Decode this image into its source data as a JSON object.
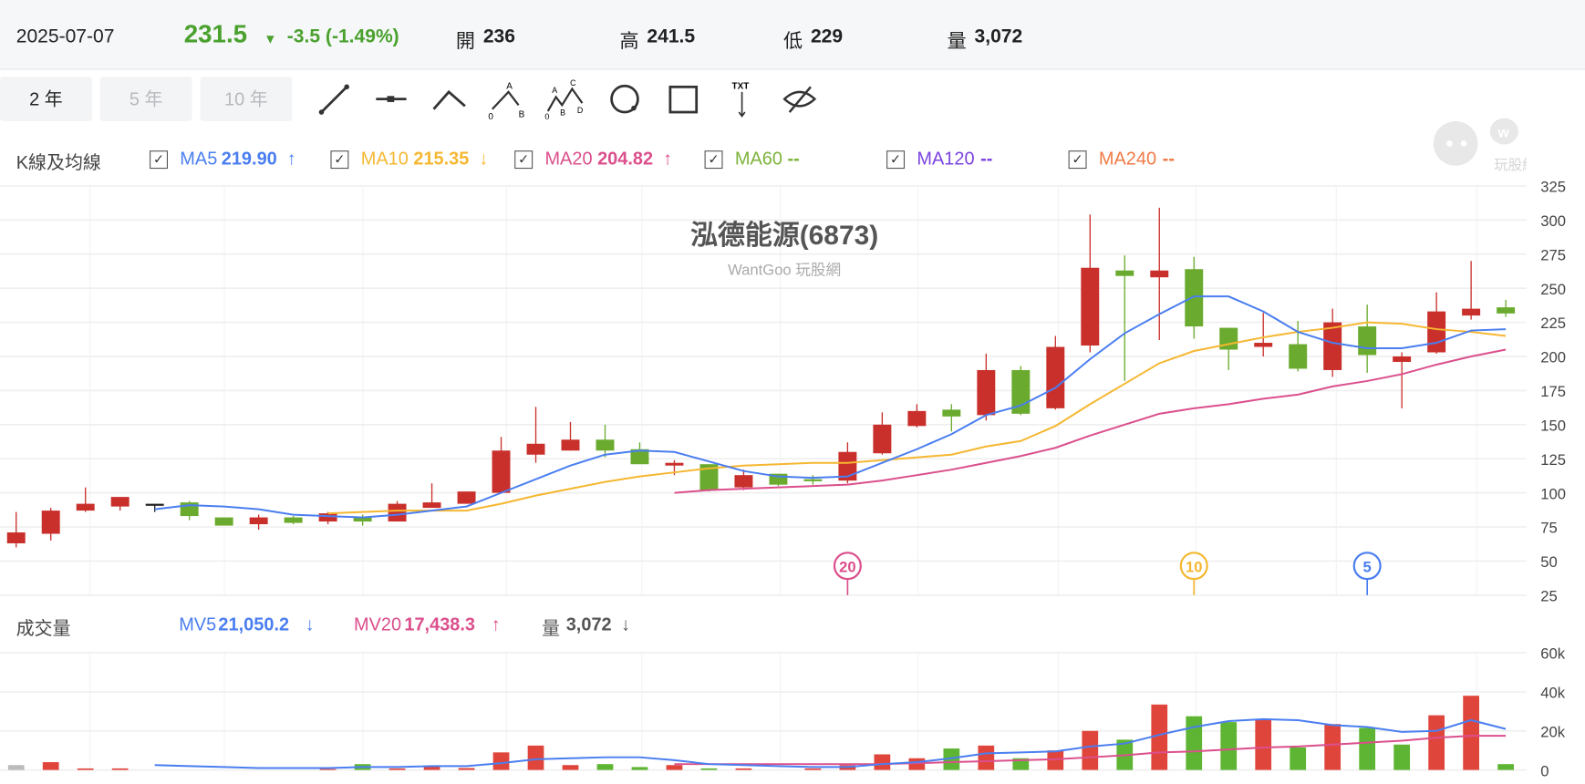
{
  "quote": {
    "date": "2025-07-07",
    "price": "231.5",
    "direction": "down",
    "change": "-3.5 (-1.49%)",
    "open_label": "開",
    "open": "236",
    "high_label": "高",
    "high": "241.5",
    "low_label": "低",
    "low": "229",
    "vol_label": "量",
    "volume": "3,072"
  },
  "ranges": [
    {
      "label": "2 年",
      "active": true
    },
    {
      "label": "5 年",
      "active": false
    },
    {
      "label": "10 年",
      "active": false
    }
  ],
  "tools": [
    "line-tool-icon",
    "horizontal-line-tool-icon",
    "angle-tool-icon",
    "abc-pattern-tool-icon",
    "abcd-pattern-tool-icon",
    "circle-tool-icon",
    "rectangle-tool-icon",
    "text-tool-icon",
    "hide-drawings-icon"
  ],
  "tool_text": {
    "txt": "TXT",
    "a": "A",
    "b": "B",
    "c": "C",
    "d": "D",
    "zero": "0"
  },
  "legend": {
    "title": "K線及均線",
    "items": [
      {
        "name": "MA5",
        "value": "219.90",
        "arrow": "↑",
        "color": "#4a7ef0",
        "checked": true
      },
      {
        "name": "MA10",
        "value": "215.35",
        "arrow": "↓",
        "color": "#f5b731",
        "checked": true
      },
      {
        "name": "MA20",
        "value": "204.82",
        "arrow": "↑",
        "color": "#db4f8c",
        "checked": true
      },
      {
        "name": "MA60",
        "value": "--",
        "arrow": "",
        "color": "#7cb33a",
        "checked": true
      },
      {
        "name": "MA120",
        "value": "--",
        "arrow": "",
        "color": "#7a43e0",
        "checked": true
      },
      {
        "name": "MA240",
        "value": "--",
        "arrow": "",
        "color": "#f07a45",
        "checked": true
      }
    ]
  },
  "watermark": {
    "title": "泓德能源(6873)",
    "subtitle": "WantGoo 玩股網",
    "logo_text": "玩股網"
  },
  "colors": {
    "up": "#c9302c",
    "down": "#6aab2f",
    "vol_up": "#e0453c",
    "vol_down": "#5db533",
    "grid": "#eeeeee"
  },
  "chart_data": [
    {
      "type": "candlestick",
      "y_ticks": [
        325,
        300,
        275,
        250,
        225,
        200,
        175,
        150,
        125,
        100,
        75,
        50,
        25
      ],
      "ylim": [
        25,
        325
      ],
      "candles": [
        [
          63,
          71,
          86,
          60
        ],
        [
          70,
          87,
          89,
          65
        ],
        [
          87,
          92,
          104,
          86
        ],
        [
          90,
          97,
          97,
          87
        ],
        [
          92,
          92,
          92,
          86
        ],
        [
          93,
          83,
          94,
          80
        ],
        [
          82,
          76,
          82,
          76
        ],
        [
          77,
          82,
          84,
          73
        ],
        [
          82,
          78,
          83,
          77
        ],
        [
          79,
          85,
          86,
          77
        ],
        [
          82,
          79,
          84,
          76
        ],
        [
          79,
          92,
          94,
          79
        ],
        [
          89,
          93,
          107,
          89
        ],
        [
          92,
          101,
          101,
          92
        ],
        [
          100,
          131,
          141,
          100
        ],
        [
          128,
          136,
          163,
          122
        ],
        [
          131,
          139,
          152,
          131
        ],
        [
          139,
          131,
          150,
          126
        ],
        [
          132,
          121,
          137,
          121
        ],
        [
          120,
          122,
          124,
          113
        ],
        [
          121,
          102,
          121,
          101
        ],
        [
          104,
          113,
          117,
          102
        ],
        [
          114,
          106,
          114,
          105
        ],
        [
          110,
          109,
          113,
          106
        ],
        [
          109,
          130,
          137,
          107
        ],
        [
          129,
          150,
          159,
          128
        ],
        [
          149,
          160,
          165,
          148
        ],
        [
          161,
          156,
          165,
          145
        ],
        [
          157,
          190,
          202,
          153
        ],
        [
          190,
          158,
          193,
          157
        ],
        [
          162,
          207,
          215,
          161
        ],
        [
          208,
          265,
          304,
          203
        ],
        [
          263,
          259,
          274,
          182
        ],
        [
          258,
          263,
          309,
          212
        ],
        [
          264,
          222,
          273,
          213
        ],
        [
          221,
          205,
          221,
          190
        ],
        [
          207,
          210,
          232,
          200
        ],
        [
          209,
          191,
          226,
          189
        ],
        [
          190,
          225,
          235,
          185
        ],
        [
          222,
          201,
          238,
          188
        ],
        [
          196,
          200,
          203,
          162
        ],
        [
          203,
          233,
          247,
          202
        ],
        [
          230,
          235,
          270,
          227
        ],
        [
          236,
          231.5,
          241.5,
          229
        ]
      ],
      "candle_fields": [
        "open",
        "close",
        "high",
        "low"
      ],
      "ma5": {
        "start": 4,
        "values": [
          88,
          91,
          90,
          88,
          84,
          83,
          82,
          84,
          87,
          90,
          100,
          110,
          120,
          128,
          131,
          130,
          123,
          116,
          112,
          111,
          112,
          122,
          132,
          143,
          157,
          164,
          177,
          198,
          217,
          231,
          244,
          244,
          233,
          218,
          210,
          206,
          206,
          210,
          219,
          220
        ]
      },
      "ma10": {
        "start": 9,
        "values": [
          85,
          86,
          87,
          87,
          87,
          92,
          98,
          103,
          108,
          112,
          115,
          118,
          120,
          121,
          122,
          122,
          124,
          126,
          128,
          134,
          138,
          149,
          165,
          180,
          195,
          204,
          209,
          214,
          218,
          221,
          225,
          224,
          220,
          218,
          215
        ]
      },
      "ma20": {
        "start": 19,
        "values": [
          100,
          102,
          103,
          104,
          105,
          106,
          109,
          113,
          117,
          122,
          127,
          133,
          142,
          150,
          158,
          162,
          165,
          169,
          172,
          178,
          182,
          187,
          194,
          200,
          205
        ]
      },
      "markers": [
        {
          "label": "20",
          "index": 24,
          "color": "#db4f8c"
        },
        {
          "label": "10",
          "index": 34,
          "color": "#f5b731"
        },
        {
          "label": "5",
          "index": 39,
          "color": "#4a7ef0"
        }
      ]
    },
    {
      "type": "bar",
      "title": "成交量",
      "y_ticks": [
        "60k",
        "40k",
        "20k",
        "0"
      ],
      "ylim": [
        0,
        60
      ],
      "unit": "k",
      "values": [
        2.5,
        4,
        0.8,
        0.8,
        0,
        0,
        0,
        0,
        0,
        0.5,
        3,
        0.8,
        2,
        1,
        9,
        12.5,
        2.5,
        3,
        1.5,
        2.5,
        0.8,
        0.8,
        0,
        0.8,
        2.5,
        8,
        6,
        11,
        12.5,
        6,
        10,
        20,
        15.5,
        33.5,
        27.5,
        24.5,
        26,
        11.5,
        23.5,
        21.5,
        13,
        28,
        38,
        3
      ],
      "colors": [
        "gray",
        "up",
        "up",
        "up",
        "up",
        "down",
        "up",
        "up",
        "down",
        "up",
        "down",
        "up",
        "up",
        "up",
        "up",
        "up",
        "up",
        "down",
        "down",
        "up",
        "down",
        "up",
        "down",
        "up",
        "up",
        "up",
        "up",
        "down",
        "up",
        "down",
        "up",
        "up",
        "down",
        "up",
        "down",
        "down",
        "up",
        "down",
        "up",
        "down",
        "down",
        "up",
        "up",
        "down"
      ],
      "mv5": {
        "start": 4,
        "values": [
          2.5,
          2,
          1.5,
          1,
          1,
          1,
          1.5,
          1.5,
          2,
          2,
          3.5,
          5.5,
          6,
          6.5,
          6.5,
          5,
          3,
          2.5,
          2,
          1.5,
          1.5,
          3,
          4,
          6,
          8.5,
          9,
          9.5,
          12,
          13.5,
          18,
          22,
          25,
          26,
          25.5,
          23,
          22,
          19.5,
          20,
          25.5,
          21
        ]
      },
      "mv20": {
        "start": 19,
        "values": [
          3,
          3,
          3,
          3,
          3,
          3,
          3,
          3.5,
          4,
          4.5,
          5,
          5.5,
          6.5,
          7.5,
          9,
          9.5,
          10.5,
          11.5,
          12,
          13,
          14,
          15,
          16.5,
          17.5,
          17.5
        ]
      },
      "legend": [
        {
          "name": "MV5",
          "value": "21,050.2",
          "arrow": "↓",
          "color": "#4a7ef0"
        },
        {
          "name": "MV20",
          "value": "17,438.3",
          "arrow": "↑",
          "color": "#db4f8c"
        },
        {
          "name": "量",
          "value": "3,072",
          "arrow": "↓",
          "color": "#555555"
        }
      ]
    }
  ]
}
